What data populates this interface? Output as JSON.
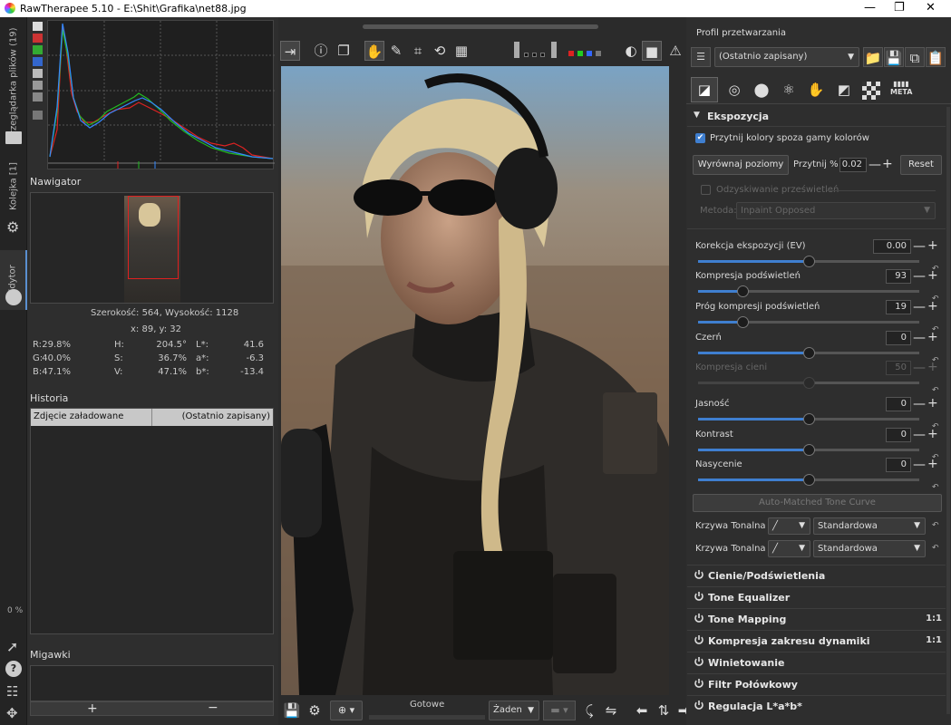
{
  "window": {
    "title": "RawTherapee 5.10 - E:\\Shit\\Grafika\\net88.jpg",
    "controls": [
      "—",
      "❐",
      "✕"
    ]
  },
  "vtabs": {
    "file_browser": "Przeglądarka plików (19)",
    "queue": "Kolejka [1]",
    "editor": "Edytor",
    "progress": "0 %"
  },
  "navigator": {
    "title": "Nawigator",
    "size_text": "Szerokość: 564, Wysokość: 1128",
    "coords": "x: 89, y: 32",
    "readouts": [
      {
        "l": "R:",
        "v": "29.8%"
      },
      {
        "l": "H:",
        "v": "204.5°"
      },
      {
        "l": "L*:",
        "v": "41.6"
      },
      {
        "l": "G:",
        "v": "40.0%"
      },
      {
        "l": "S:",
        "v": "36.7%"
      },
      {
        "l": "a*:",
        "v": "-6.3"
      },
      {
        "l": "B:",
        "v": "47.1%"
      },
      {
        "l": "V:",
        "v": "47.1%"
      },
      {
        "l": "b*:",
        "v": "-13.4"
      }
    ]
  },
  "history": {
    "title": "Historia",
    "col1": "Zdjęcie załadowane",
    "col2": "(Ostatnio zapisany)"
  },
  "snapshots": {
    "title": "Migawki",
    "add": "+",
    "remove": "−"
  },
  "bottombar": {
    "status": "Gotowe",
    "zoom_combo": "Żaden"
  },
  "profile": {
    "title": "Profil przetwarzania",
    "selected": "(Ostatnio zapisany)"
  },
  "exposure": {
    "title": "Ekspozycja",
    "clip_check": "Przytnij kolory spoza gamy kolorów",
    "auto_levels": "Wyrównaj poziomy",
    "clip_label": "Przytnij %",
    "clip_value": "0.02",
    "reset": "Reset",
    "hl_recovery": "Odzyskiwanie prześwietleń",
    "method_label": "Metoda:",
    "method_value": "Inpaint Opposed",
    "sliders": [
      {
        "label": "Korekcja ekspozycji (EV)",
        "value": "0.00",
        "pos": 0.5,
        "enabled": true
      },
      {
        "label": "Kompresja podświetleń",
        "value": "93",
        "pos": 0.2,
        "enabled": true
      },
      {
        "label": "Próg kompresji podświetleń",
        "value": "19",
        "pos": 0.2,
        "enabled": true
      },
      {
        "label": "Czerń",
        "value": "0",
        "pos": 0.5,
        "enabled": true
      },
      {
        "label": "Kompresja cieni",
        "value": "50",
        "pos": 0.5,
        "enabled": false
      },
      {
        "label": "Jasność",
        "value": "0",
        "pos": 0.5,
        "enabled": true
      },
      {
        "label": "Kontrast",
        "value": "0",
        "pos": 0.5,
        "enabled": true
      },
      {
        "label": "Nasycenie",
        "value": "0",
        "pos": 0.5,
        "enabled": true
      }
    ],
    "amtc": "Auto-Matched Tone Curve",
    "curve1_label": "Krzywa Tonalna 1:",
    "curve1_value": "Standardowa",
    "curve2_label": "Krzywa Tonalna 2:",
    "curve2_value": "Standardowa"
  },
  "sections": [
    {
      "name": "Cienie/Podświetlenia",
      "extra": ""
    },
    {
      "name": "Tone Equalizer",
      "extra": ""
    },
    {
      "name": "Tone Mapping",
      "extra": "1:1"
    },
    {
      "name": "Kompresja zakresu dynamiki",
      "extra": "1:1"
    },
    {
      "name": "Winietowanie",
      "extra": ""
    },
    {
      "name": "Filtr Połówkowy",
      "extra": ""
    },
    {
      "name": "Regulacja L*a*b*",
      "extra": ""
    }
  ],
  "tool_tabs": [
    "exposure-tab",
    "detail-tab",
    "color-tab",
    "advanced-tab",
    "transform-tab",
    "raw-tab",
    "meta-tab"
  ],
  "meta_tab_label": "META"
}
